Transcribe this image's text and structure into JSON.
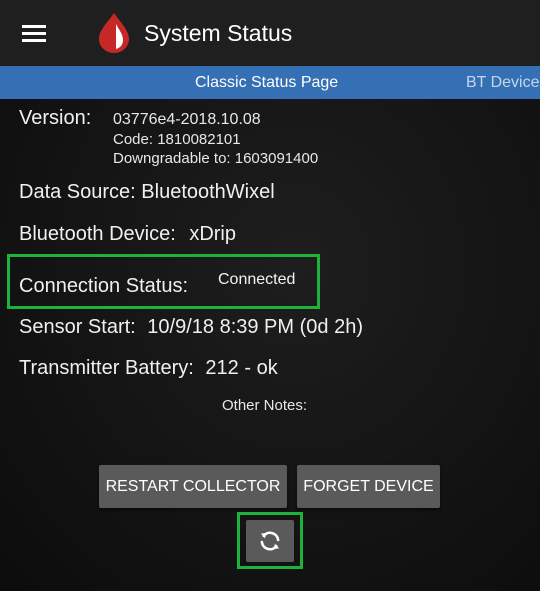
{
  "appbar": {
    "title": "System Status",
    "menu_icon": "hamburger-menu-icon",
    "logo_icon": "blood-drop-logo",
    "logo_colors": {
      "outer": "#c62828",
      "inner": "#ffffff"
    }
  },
  "tabs": [
    {
      "label": "Classic Status Page",
      "active": true
    },
    {
      "label": "BT Device",
      "active": false
    }
  ],
  "tab_bar_color": "#3570b4",
  "status": {
    "version_label": "Version:",
    "version_value": "03776e4-2018.10.08",
    "code_line": "Code: 1810082101",
    "downgradable_line": "Downgradable to: 1603091400",
    "data_source_label": "Data Source:",
    "data_source_value": "BluetoothWixel",
    "bt_device_label": "Bluetooth Device:",
    "bt_device_value": "xDrip",
    "connection_label": "Connection Status:",
    "connection_value": "Connected",
    "sensor_start_label": "Sensor Start:",
    "sensor_start_value": "10/9/18 8:39 PM (0d 2h)",
    "battery_label": "Transmitter Battery:",
    "battery_value": "212 - ok",
    "other_notes_label": "Other Notes:"
  },
  "buttons": {
    "restart_collector": "RESTART COLLECTOR",
    "forget_device": "FORGET DEVICE",
    "refresh_icon": "refresh-icon"
  },
  "highlight_color": "#1db33a"
}
